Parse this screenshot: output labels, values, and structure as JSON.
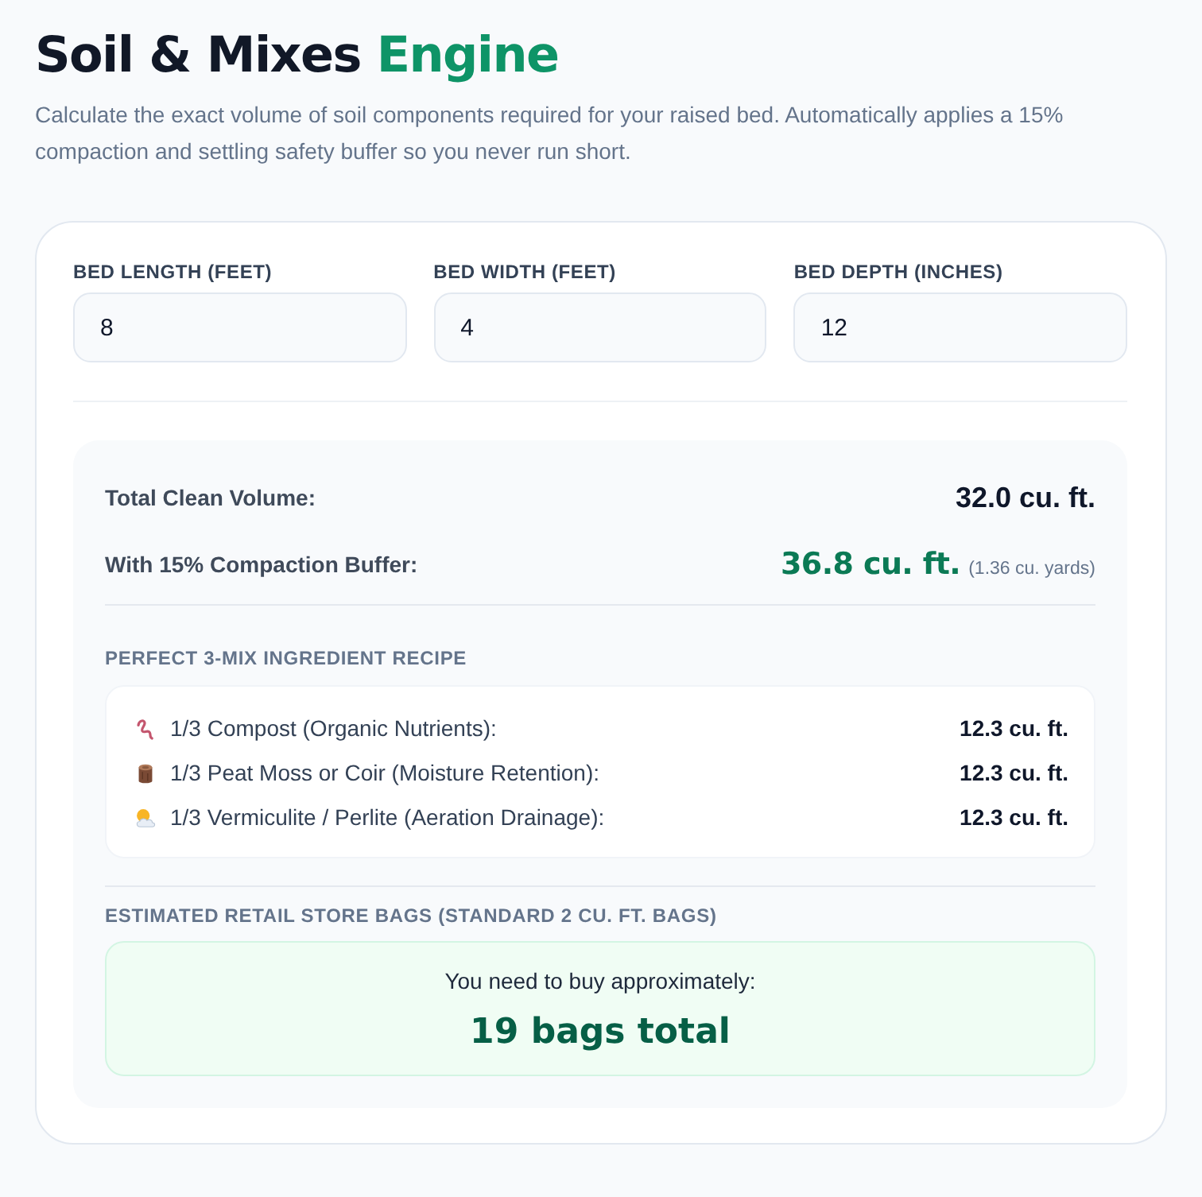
{
  "header": {
    "title": "Soil & Mixes",
    "title_accent": "Engine",
    "subtitle": "Calculate the exact volume of soil components required for your raised bed. Automatically applies a 15% compaction and settling safety buffer so you never run short."
  },
  "inputs": [
    {
      "label": "BED LENGTH (FEET)",
      "value": "8"
    },
    {
      "label": "BED WIDTH (FEET)",
      "value": "4"
    },
    {
      "label": "BED DEPTH (INCHES)",
      "value": "12"
    }
  ],
  "summary": [
    {
      "kind": "plain",
      "label": "Total Clean Volume:",
      "value": "32.0 cu. ft."
    },
    {
      "kind": "highlight",
      "label": "With 15% Compaction Buffer:",
      "value": "36.8 cu. ft.",
      "note": "(1.36 cu. yards)"
    }
  ],
  "recipe": {
    "heading": "PERFECT 3-MIX INGREDIENT RECIPE",
    "items": [
      {
        "kind": "compost",
        "label": "1/3 Compost (Organic Nutrients):",
        "amount": "12.3 cu. ft."
      },
      {
        "kind": "peat",
        "label": "1/3 Peat Moss or Coir (Moisture Retention):",
        "amount": "12.3 cu. ft."
      },
      {
        "kind": "aeration",
        "label": "1/3 Vermiculite / Perlite (Aeration Drainage):",
        "amount": "12.3 cu. ft."
      }
    ]
  },
  "bags": {
    "heading": "ESTIMATED RETAIL STORE BAGS (STANDARD 2 CU. FT. BAGS)",
    "lead": "You need to buy approximately:",
    "total": "19 bags total"
  }
}
